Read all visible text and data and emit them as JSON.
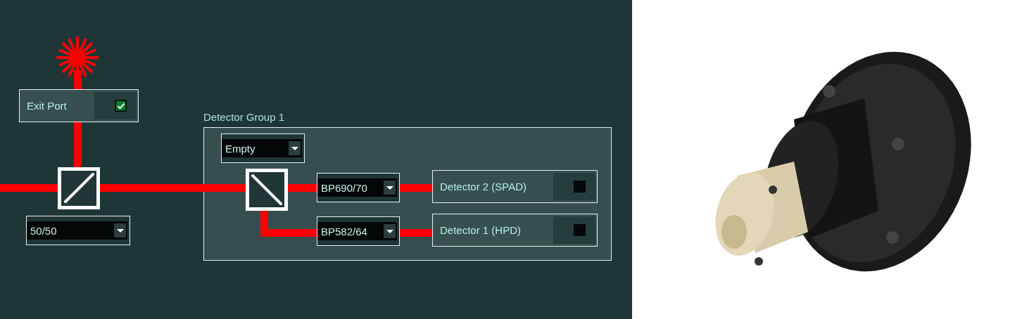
{
  "exit_port": {
    "label": "Exit Port",
    "checked": true
  },
  "splitter": {
    "value": "50/50"
  },
  "detector_group": {
    "title": "Detector Group 1",
    "splitter": {
      "value": "Empty"
    },
    "channels": [
      {
        "filter": "BP690/70",
        "detector": "Detector 2 (SPAD)",
        "checked": false
      },
      {
        "filter": "BP582/64",
        "detector": "Detector 1 (HPD)",
        "checked": false
      }
    ]
  }
}
